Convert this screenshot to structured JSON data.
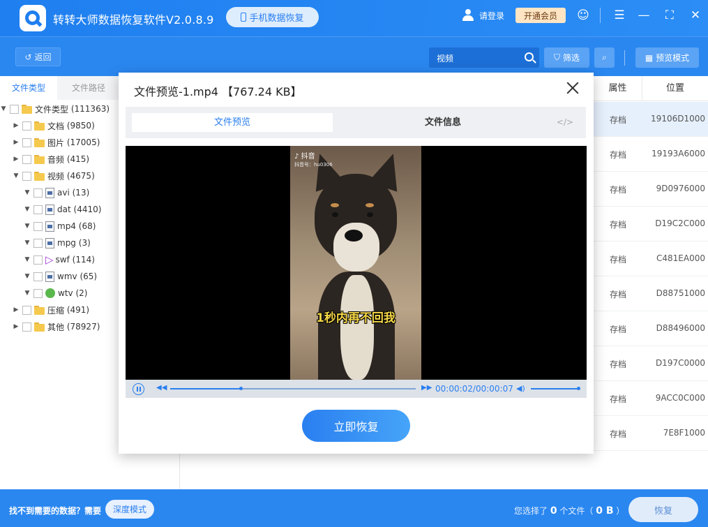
{
  "app": {
    "title": "转转大师数据恢复软件V2.0.8.9",
    "phone_recovery": "手机数据恢复",
    "login": "请登录",
    "vip": "开通会员"
  },
  "toolbar": {
    "back": "返回",
    "search_value": "视频",
    "filter": "筛选",
    "preview_mode": "预览模式"
  },
  "sidebar": {
    "tab_type": "文件类型",
    "tab_path": "文件路径",
    "root": {
      "label": "文件类型",
      "count": "(111363)"
    },
    "items": [
      {
        "label": "文档",
        "count": "(9850)"
      },
      {
        "label": "图片",
        "count": "(17005)"
      },
      {
        "label": "音频",
        "count": "(415)"
      },
      {
        "label": "视频",
        "count": "(4675)"
      }
    ],
    "video_children": [
      {
        "label": "avi",
        "count": "(13)"
      },
      {
        "label": "dat",
        "count": "(4410)"
      },
      {
        "label": "mp4",
        "count": "(68)"
      },
      {
        "label": "mpg",
        "count": "(3)"
      },
      {
        "label": "swf",
        "count": "(114)"
      },
      {
        "label": "wmv",
        "count": "(65)"
      },
      {
        "label": "wtv",
        "count": "(2)"
      }
    ],
    "after": [
      {
        "label": "压缩",
        "count": "(491)"
      },
      {
        "label": "其他",
        "count": "(78927)"
      }
    ]
  },
  "table": {
    "col_attr": "属性",
    "col_pos": "位置",
    "rows": [
      {
        "attr": "存档",
        "pos": "19106D1000"
      },
      {
        "attr": "存档",
        "pos": "19193A6000"
      },
      {
        "attr": "存档",
        "pos": "9D0976000"
      },
      {
        "attr": "存档",
        "pos": "D19C2C000"
      },
      {
        "attr": "存档",
        "pos": "C481EA000"
      },
      {
        "attr": "存档",
        "pos": "D88751000"
      },
      {
        "attr": "存档",
        "pos": "D88496000"
      },
      {
        "attr": "存档",
        "pos": "D197C0000"
      },
      {
        "attr": "存档",
        "pos": "9ACC0C000"
      },
      {
        "attr": "存档",
        "pos": "7E8F1000"
      }
    ]
  },
  "modal": {
    "title": "文件预览-1.mp4 【767.24 KB】",
    "tab_preview": "文件预览",
    "tab_info": "文件信息",
    "tab_code": "</>",
    "tiktok_label": "抖音",
    "tiktok_id": "抖音号：hu0306",
    "caption": "1秒内再不回我",
    "time": "00:00:02/00:00:07",
    "progress_fraction": 0.286,
    "recover_now": "立即恢复"
  },
  "bottom": {
    "missing": "找不到需要的数据？需要",
    "deep_mode": "深度模式",
    "selected_prefix": "您选择了",
    "selected_count": "0",
    "selected_mid": "个文件（",
    "selected_size": "0 B",
    "selected_suffix": "）",
    "recover": "恢复"
  },
  "colors": {
    "accent": "#2a7ff0",
    "vip_bg": "#ffe5c4",
    "caption": "#f4d646"
  }
}
